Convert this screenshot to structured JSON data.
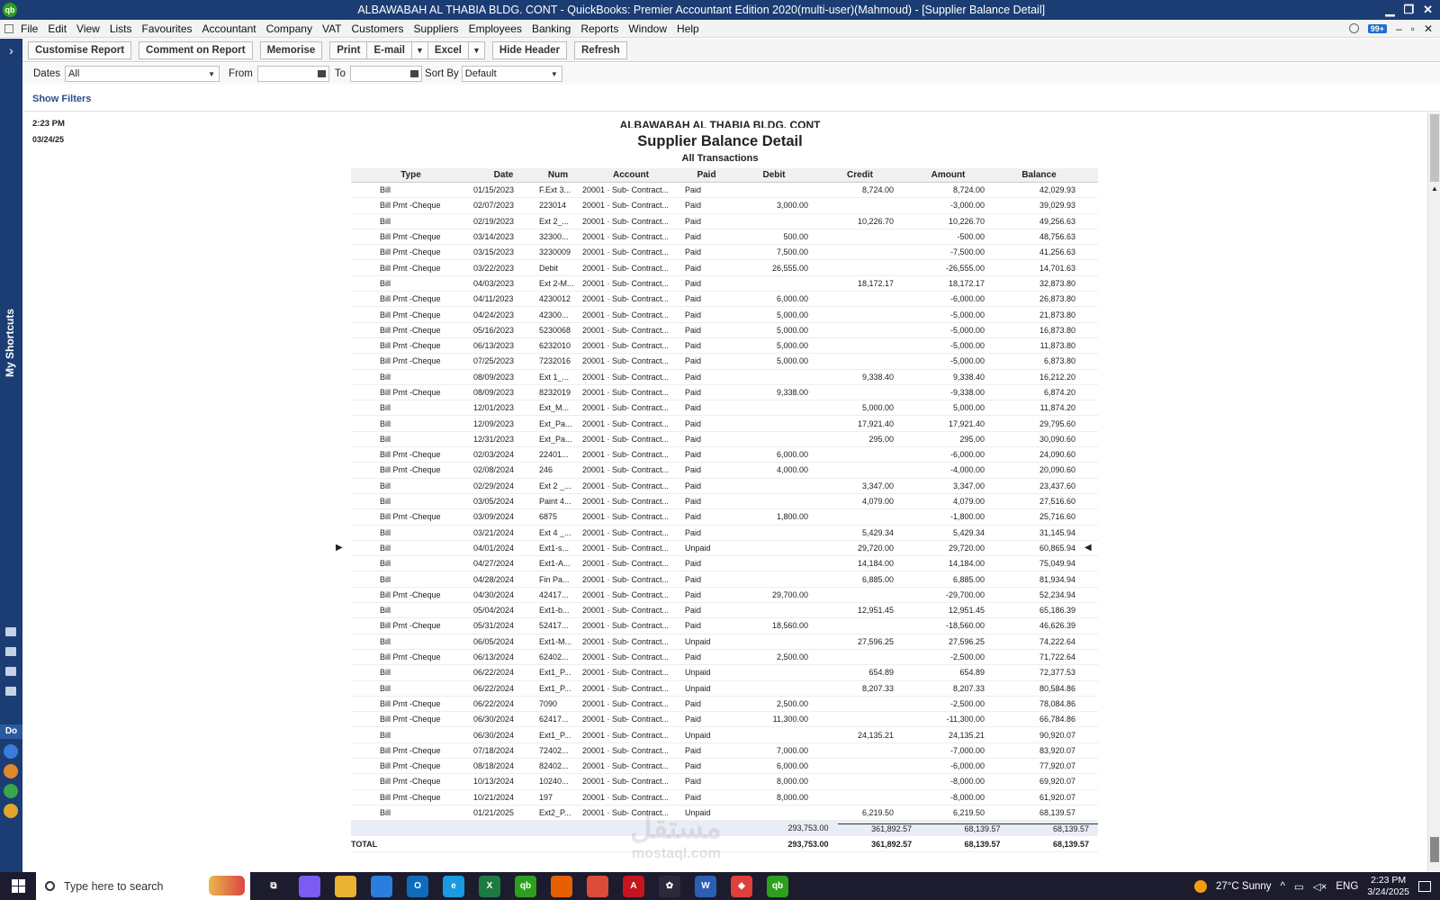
{
  "window": {
    "title": "ALBAWABAH AL THABIA BLDG. CONT  - QuickBooks: Premier Accountant Edition 2020(multi-user)(Mahmoud) - [Supplier Balance Detail]",
    "logo": "qb",
    "controls": [
      "▁",
      "❐",
      "✕"
    ]
  },
  "menu": {
    "items": [
      "File",
      "Edit",
      "View",
      "Lists",
      "Favourites",
      "Accountant",
      "Company",
      "VAT",
      "Customers",
      "Suppliers",
      "Employees",
      "Banking",
      "Reports",
      "Window",
      "Help"
    ],
    "badge": "99+",
    "controls": [
      "–",
      "▫",
      "✕"
    ]
  },
  "sidebar": {
    "label": "My Shortcuts",
    "toggle": "›",
    "section": "Do"
  },
  "toolbar": {
    "customise": "Customise Report",
    "comment": "Comment on Report",
    "memorise": "Memorise",
    "print": "Print",
    "email": "E-mail",
    "excel": "Excel",
    "hide_header": "Hide Header",
    "refresh": "Refresh",
    "dropdown_arrow": "▼"
  },
  "filters": {
    "dates_label": "Dates",
    "dates_value": "All",
    "from_label": "From",
    "from_value": "",
    "to_label": "To",
    "to_value": "",
    "sort_label": "Sort By",
    "sort_value": "Default",
    "show_filters": "Show Filters"
  },
  "report": {
    "time": "2:23 PM",
    "date": "03/24/25",
    "company": "ALBAWABAH AL THABIA BLDG. CONT",
    "title": "Supplier Balance Detail",
    "subtitle": "All Transactions",
    "columns": [
      "Type",
      "Date",
      "Num",
      "Account",
      "Paid",
      "Debit",
      "Credit",
      "Amount",
      "Balance"
    ],
    "rows": [
      [
        "Bill",
        "01/15/2023",
        "F.Ext 3...",
        "20001 · Sub- Contract...",
        "Paid",
        "",
        "8,724.00",
        "8,724.00",
        "42,029.93"
      ],
      [
        "Bill Pmt -Cheque",
        "02/07/2023",
        "223014",
        "20001 · Sub- Contract...",
        "Paid",
        "3,000.00",
        "",
        "-3,000.00",
        "39,029.93"
      ],
      [
        "Bill",
        "02/19/2023",
        "Ext 2_...",
        "20001 · Sub- Contract...",
        "Paid",
        "",
        "10,226.70",
        "10,226.70",
        "49,256.63"
      ],
      [
        "Bill Pmt -Cheque",
        "03/14/2023",
        "32300...",
        "20001 · Sub- Contract...",
        "Paid",
        "500.00",
        "",
        "-500.00",
        "48,756.63"
      ],
      [
        "Bill Pmt -Cheque",
        "03/15/2023",
        "3230009",
        "20001 · Sub- Contract...",
        "Paid",
        "7,500.00",
        "",
        "-7,500.00",
        "41,256.63"
      ],
      [
        "Bill Pmt -Cheque",
        "03/22/2023",
        "Debit",
        "20001 · Sub- Contract...",
        "Paid",
        "26,555.00",
        "",
        "-26,555.00",
        "14,701.63"
      ],
      [
        "Bill",
        "04/03/2023",
        "Ext 2-M...",
        "20001 · Sub- Contract...",
        "Paid",
        "",
        "18,172.17",
        "18,172.17",
        "32,873.80"
      ],
      [
        "Bill Pmt -Cheque",
        "04/11/2023",
        "4230012",
        "20001 · Sub- Contract...",
        "Paid",
        "6,000.00",
        "",
        "-6,000.00",
        "26,873.80"
      ],
      [
        "Bill Pmt -Cheque",
        "04/24/2023",
        "42300...",
        "20001 · Sub- Contract...",
        "Paid",
        "5,000.00",
        "",
        "-5,000.00",
        "21,873.80"
      ],
      [
        "Bill Pmt -Cheque",
        "05/16/2023",
        "5230068",
        "20001 · Sub- Contract...",
        "Paid",
        "5,000.00",
        "",
        "-5,000.00",
        "16,873.80"
      ],
      [
        "Bill Pmt -Cheque",
        "06/13/2023",
        "6232010",
        "20001 · Sub- Contract...",
        "Paid",
        "5,000.00",
        "",
        "-5,000.00",
        "11,873.80"
      ],
      [
        "Bill Pmt -Cheque",
        "07/25/2023",
        "7232016",
        "20001 · Sub- Contract...",
        "Paid",
        "5,000.00",
        "",
        "-5,000.00",
        "6,873.80"
      ],
      [
        "Bill",
        "08/09/2023",
        "Ext 1_...",
        "20001 · Sub- Contract...",
        "Paid",
        "",
        "9,338.40",
        "9,338.40",
        "16,212.20"
      ],
      [
        "Bill Pmt -Cheque",
        "08/09/2023",
        "8232019",
        "20001 · Sub- Contract...",
        "Paid",
        "9,338.00",
        "",
        "-9,338.00",
        "6,874.20"
      ],
      [
        "Bill",
        "12/01/2023",
        "Ext_M...",
        "20001 · Sub- Contract...",
        "Paid",
        "",
        "5,000.00",
        "5,000.00",
        "11,874.20"
      ],
      [
        "Bill",
        "12/09/2023",
        "Ext_Pa...",
        "20001 · Sub- Contract...",
        "Paid",
        "",
        "17,921.40",
        "17,921.40",
        "29,795.60"
      ],
      [
        "Bill",
        "12/31/2023",
        "Ext_Pa...",
        "20001 · Sub- Contract...",
        "Paid",
        "",
        "295.00",
        "295.00",
        "30,090.60"
      ],
      [
        "Bill Pmt -Cheque",
        "02/03/2024",
        "22401...",
        "20001 · Sub- Contract...",
        "Paid",
        "6,000.00",
        "",
        "-6,000.00",
        "24,090.60"
      ],
      [
        "Bill Pmt -Cheque",
        "02/08/2024",
        "246",
        "20001 · Sub- Contract...",
        "Paid",
        "4,000.00",
        "",
        "-4,000.00",
        "20,090.60"
      ],
      [
        "Bill",
        "02/29/2024",
        "Ext 2 _...",
        "20001 · Sub- Contract...",
        "Paid",
        "",
        "3,347.00",
        "3,347.00",
        "23,437.60"
      ],
      [
        "Bill",
        "03/05/2024",
        "Paint 4...",
        "20001 · Sub- Contract...",
        "Paid",
        "",
        "4,079.00",
        "4,079.00",
        "27,516.60"
      ],
      [
        "Bill Pmt -Cheque",
        "03/09/2024",
        "6875",
        "20001 · Sub- Contract...",
        "Paid",
        "1,800.00",
        "",
        "-1,800.00",
        "25,716.60"
      ],
      [
        "Bill",
        "03/21/2024",
        "Ext 4 _...",
        "20001 · Sub- Contract...",
        "Paid",
        "",
        "5,429.34",
        "5,429.34",
        "31,145.94"
      ],
      [
        "Bill",
        "04/01/2024",
        "Ext1-s...",
        "20001 · Sub- Contract...",
        "Unpaid",
        "",
        "29,720.00",
        "29,720.00",
        "60,865.94"
      ],
      [
        "Bill",
        "04/27/2024",
        "Ext1-A...",
        "20001 · Sub- Contract...",
        "Paid",
        "",
        "14,184.00",
        "14,184.00",
        "75,049.94"
      ],
      [
        "Bill",
        "04/28/2024",
        "Fin Pa...",
        "20001 · Sub- Contract...",
        "Paid",
        "",
        "6,885.00",
        "6,885.00",
        "81,934.94"
      ],
      [
        "Bill Pmt -Cheque",
        "04/30/2024",
        "42417...",
        "20001 · Sub- Contract...",
        "Paid",
        "29,700.00",
        "",
        "-29,700.00",
        "52,234.94"
      ],
      [
        "Bill",
        "05/04/2024",
        "Ext1-b...",
        "20001 · Sub- Contract...",
        "Paid",
        "",
        "12,951.45",
        "12,951.45",
        "65,186.39"
      ],
      [
        "Bill Pmt -Cheque",
        "05/31/2024",
        "52417...",
        "20001 · Sub- Contract...",
        "Paid",
        "18,560.00",
        "",
        "-18,560.00",
        "46,626.39"
      ],
      [
        "Bill",
        "06/05/2024",
        "Ext1-M...",
        "20001 · Sub- Contract...",
        "Unpaid",
        "",
        "27,596.25",
        "27,596.25",
        "74,222.64"
      ],
      [
        "Bill Pmt -Cheque",
        "06/13/2024",
        "62402...",
        "20001 · Sub- Contract...",
        "Paid",
        "2,500.00",
        "",
        "-2,500.00",
        "71,722.64"
      ],
      [
        "Bill",
        "06/22/2024",
        "Ext1_P...",
        "20001 · Sub- Contract...",
        "Unpaid",
        "",
        "654.89",
        "654.89",
        "72,377.53"
      ],
      [
        "Bill",
        "06/22/2024",
        "Ext1_P...",
        "20001 · Sub- Contract...",
        "Unpaid",
        "",
        "8,207.33",
        "8,207.33",
        "80,584.86"
      ],
      [
        "Bill Pmt -Cheque",
        "06/22/2024",
        "7090",
        "20001 · Sub- Contract...",
        "Paid",
        "2,500.00",
        "",
        "-2,500.00",
        "78,084.86"
      ],
      [
        "Bill Pmt -Cheque",
        "06/30/2024",
        "62417...",
        "20001 · Sub- Contract...",
        "Paid",
        "11,300.00",
        "",
        "-11,300.00",
        "66,784.86"
      ],
      [
        "Bill",
        "06/30/2024",
        "Ext1_P...",
        "20001 · Sub- Contract...",
        "Unpaid",
        "",
        "24,135.21",
        "24,135.21",
        "90,920.07"
      ],
      [
        "Bill Pmt -Cheque",
        "07/18/2024",
        "72402...",
        "20001 · Sub- Contract...",
        "Paid",
        "7,000.00",
        "",
        "-7,000.00",
        "83,920.07"
      ],
      [
        "Bill Pmt -Cheque",
        "08/18/2024",
        "82402...",
        "20001 · Sub- Contract...",
        "Paid",
        "6,000.00",
        "",
        "-6,000.00",
        "77,920.07"
      ],
      [
        "Bill Pmt -Cheque",
        "10/13/2024",
        "10240...",
        "20001 · Sub- Contract...",
        "Paid",
        "8,000.00",
        "",
        "-8,000.00",
        "69,920.07"
      ],
      [
        "Bill Pmt -Cheque",
        "10/21/2024",
        "197",
        "20001 · Sub- Contract...",
        "Paid",
        "8,000.00",
        "",
        "-8,000.00",
        "61,920.07"
      ],
      [
        "Bill",
        "01/21/2025",
        "Ext2_P...",
        "20001 · Sub- Contract...",
        "Unpaid",
        "",
        "6,219.50",
        "6,219.50",
        "68,139.57"
      ]
    ],
    "subtotal": [
      "",
      "293,753.00",
      "361,892.57",
      "68,139.57",
      "68,139.57"
    ],
    "total": [
      "TOTAL",
      "293,753.00",
      "361,892.57",
      "68,139.57",
      "68,139.57"
    ],
    "selected_row_index": 23
  },
  "watermark": {
    "main": "مستقل",
    "sub": "mostaql.com"
  },
  "taskbar": {
    "search_placeholder": "Type here to search",
    "weather": "27°C  Sunny",
    "language": "ENG",
    "time": "2:23 PM",
    "date": "3/24/2025",
    "tray_arrow": "^",
    "apps": [
      {
        "name": "task-view-icon",
        "color": "#1c1c2e",
        "label": "⧉"
      },
      {
        "name": "copilot-icon",
        "color": "#7b5cf0",
        "label": ""
      },
      {
        "name": "file-explorer-icon",
        "color": "#e9b233",
        "label": ""
      },
      {
        "name": "store-icon",
        "color": "#2b7de0",
        "label": ""
      },
      {
        "name": "outlook-icon",
        "color": "#0f6cbd",
        "label": "O"
      },
      {
        "name": "edge-icon",
        "color": "#1a9ae0",
        "label": "e"
      },
      {
        "name": "excel-icon",
        "color": "#1e7a43",
        "label": "X"
      },
      {
        "name": "quickbooks-icon",
        "color": "#2ca01c",
        "label": "qb"
      },
      {
        "name": "firefox-icon",
        "color": "#e66000",
        "label": ""
      },
      {
        "name": "chrome-icon",
        "color": "#dd4b39",
        "label": ""
      },
      {
        "name": "acrobat-icon",
        "color": "#c4161c",
        "label": "A"
      },
      {
        "name": "chatgpt-icon",
        "color": "#2a2a3a",
        "label": "✿"
      },
      {
        "name": "word-icon",
        "color": "#2b5fb4",
        "label": "W"
      },
      {
        "name": "anydesk-icon",
        "color": "#e0403a",
        "label": "◆"
      },
      {
        "name": "quickbooks-active-icon",
        "color": "#2ca01c",
        "label": "qb"
      }
    ]
  }
}
